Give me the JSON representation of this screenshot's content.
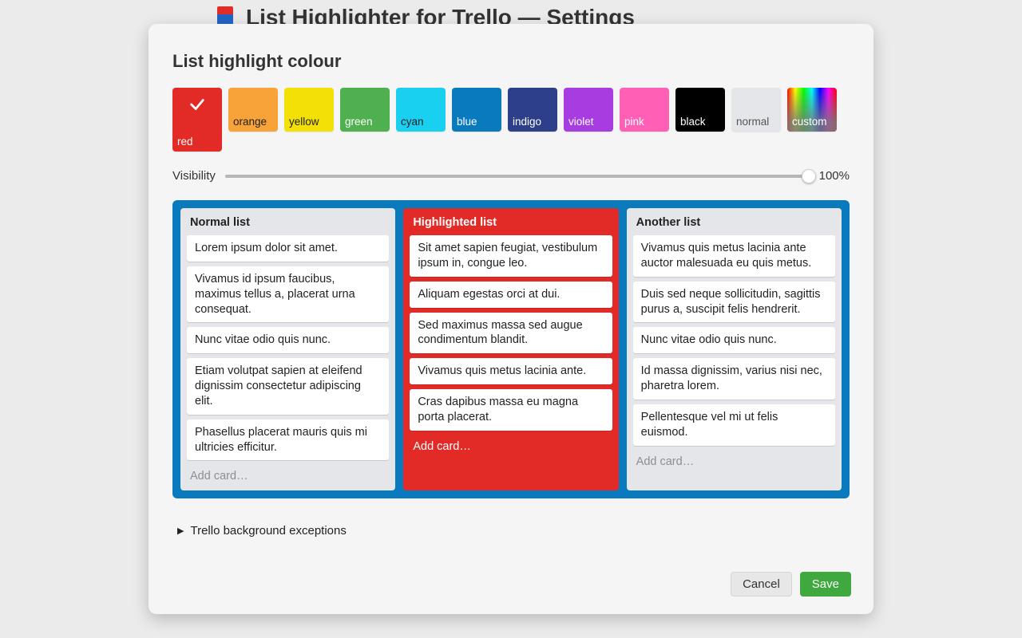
{
  "header": {
    "title": "List Highlighter for Trello — Settings"
  },
  "modal": {
    "section_title": "List highlight colour",
    "swatches": [
      {
        "id": "red",
        "label": "red",
        "color": "#e22a26",
        "text": "#ffffff",
        "selected": true
      },
      {
        "id": "orange",
        "label": "orange",
        "color": "#f8a23a",
        "text": "#222222",
        "selected": false
      },
      {
        "id": "yellow",
        "label": "yellow",
        "color": "#f3e006",
        "text": "#222222",
        "selected": false
      },
      {
        "id": "green",
        "label": "green",
        "color": "#4fb04f",
        "text": "#ffffff",
        "selected": false
      },
      {
        "id": "cyan",
        "label": "cyan",
        "color": "#1ad0f0",
        "text": "#222222",
        "selected": false
      },
      {
        "id": "blue",
        "label": "blue",
        "color": "#0a7abf",
        "text": "#ffffff",
        "selected": false
      },
      {
        "id": "indigo",
        "label": "indigo",
        "color": "#2d3f8a",
        "text": "#ffffff",
        "selected": false
      },
      {
        "id": "violet",
        "label": "violet",
        "color": "#a73de0",
        "text": "#ffffff",
        "selected": false
      },
      {
        "id": "pink",
        "label": "pink",
        "color": "#ff5fb5",
        "text": "#ffffff",
        "selected": false
      },
      {
        "id": "black",
        "label": "black",
        "color": "#000000",
        "text": "#ffffff",
        "selected": false
      },
      {
        "id": "normal",
        "label": "normal",
        "color": "#e4e6e9",
        "text": "#555555",
        "selected": false
      },
      {
        "id": "custom",
        "label": "custom",
        "color": "rainbow",
        "text": "#ffffff",
        "selected": false
      }
    ],
    "visibility": {
      "label": "Visibility",
      "value_text": "100%",
      "value_pct": 100
    },
    "preview": {
      "lists": [
        {
          "style": "normal",
          "title": "Normal list",
          "cards": [
            "Lorem ipsum dolor sit amet.",
            "Vivamus id ipsum faucibus, maximus tellus a, placerat urna consequat.",
            "Nunc vitae odio quis nunc.",
            "Etiam volutpat sapien at eleifend dignissim consectetur adipiscing elit.",
            "Phasellus placerat mauris quis mi ultricies efficitur."
          ],
          "add_label": "Add card…"
        },
        {
          "style": "highlight",
          "title": "Highlighted list",
          "cards": [
            "Sit amet sapien feugiat, vestibulum ipsum in, congue leo.",
            "Aliquam egestas orci at dui.",
            "Sed maximus massa sed augue condimentum blandit.",
            "Vivamus quis metus lacinia ante.",
            "Cras dapibus massa eu magna porta placerat."
          ],
          "add_label": "Add card…"
        },
        {
          "style": "normal",
          "title": "Another list",
          "cards": [
            "Vivamus quis metus lacinia ante auctor malesuada eu quis metus.",
            "Duis sed neque sollicitudin, sagittis purus a, suscipit felis hendrerit.",
            "Nunc vitae odio quis nunc.",
            "Id massa dignissim, varius nisi nec, pharetra lorem.",
            "Pellentesque vel mi ut felis euismod."
          ],
          "add_label": "Add card…"
        }
      ]
    },
    "disclosure_label": "Trello background exceptions",
    "buttons": {
      "cancel": "Cancel",
      "save": "Save"
    }
  }
}
